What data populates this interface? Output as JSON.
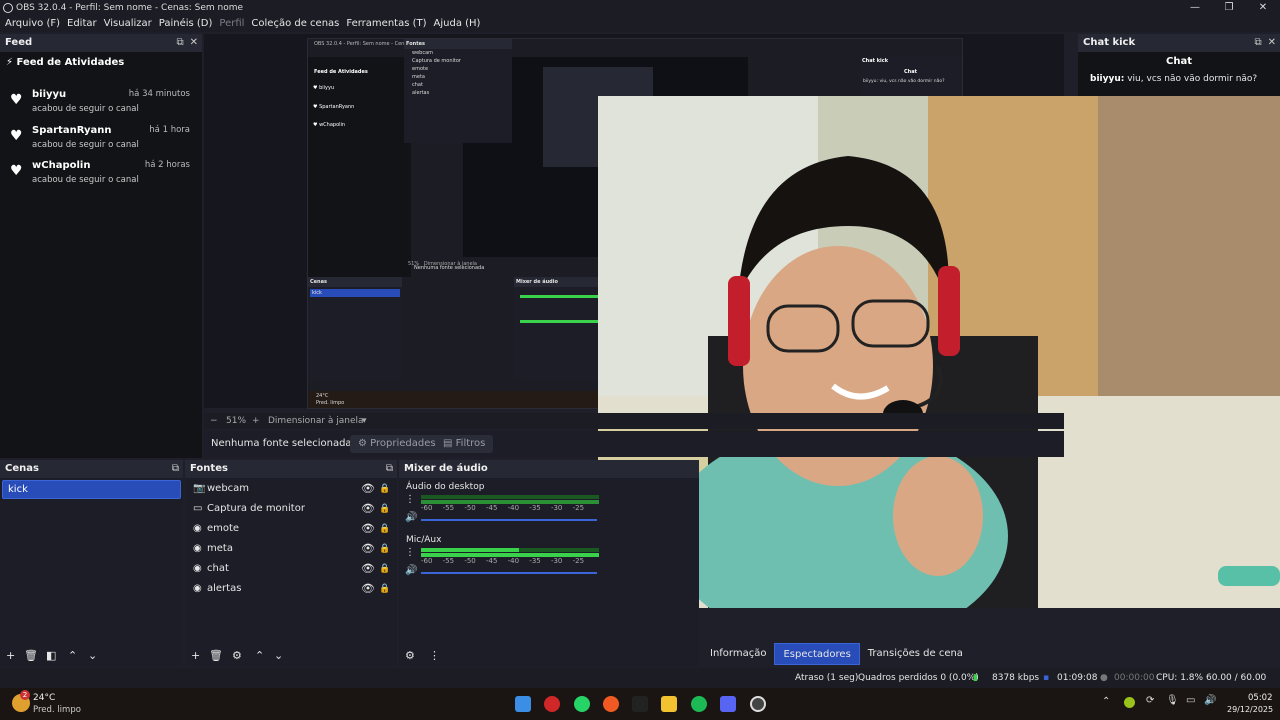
{
  "window": {
    "title": "OBS 32.0.4 - Perfil: Sem nome - Cenas: Sem nome",
    "controls": [
      "—",
      "❐",
      "✕"
    ]
  },
  "menu": {
    "items": [
      "Arquivo (F)",
      "Editar",
      "Visualizar",
      "Painéis (D)",
      "Perfil",
      "Coleção de cenas",
      "Ferramentas (T)",
      "Ajuda (H)"
    ]
  },
  "feed": {
    "dock_title": "Feed",
    "panel_title": "Feed de Atividades",
    "items": [
      {
        "name": "biiyyu",
        "time": "há 34 minutos",
        "action": "acabou de seguir o canal"
      },
      {
        "name": "SpartanRyann",
        "time": "há 1 hora",
        "action": "acabou de seguir o canal"
      },
      {
        "name": "wChapolin",
        "time": "há 2 horas",
        "action": "acabou de seguir o canal"
      }
    ]
  },
  "chat": {
    "dock_title": "Chat kick",
    "heading": "Chat",
    "messages": [
      {
        "user": "biiyyu:",
        "text": "viu, vcs não vão dormir não?"
      }
    ]
  },
  "preview": {
    "zoom": "51%",
    "zoom_mode": "Dimensionar à janela",
    "no_source": "Nenhuma fonte selecionada",
    "properties": "Propriedades",
    "filters": "Filtros"
  },
  "scenes": {
    "title": "Cenas",
    "items": [
      "kick"
    ]
  },
  "sources": {
    "title": "Fontes",
    "items": [
      {
        "label": "webcam",
        "icon": "camera-icon"
      },
      {
        "label": "Captura de monitor",
        "icon": "monitor-icon"
      },
      {
        "label": "emote",
        "icon": "browser-icon"
      },
      {
        "label": "meta",
        "icon": "browser-icon"
      },
      {
        "label": "chat",
        "icon": "browser-icon"
      },
      {
        "label": "alertas",
        "icon": "browser-icon"
      }
    ]
  },
  "mixer": {
    "title": "Mixer de áudio",
    "tracks": [
      {
        "name": "Áudio do desktop",
        "level": 0.0
      },
      {
        "name": "Mic/Aux",
        "level": 0.55
      }
    ],
    "scale": "-60 -55 -50 -45 -40 -35 -30 -25"
  },
  "tabs": [
    "Informação",
    "Espectadores",
    "Transições de cena"
  ],
  "status": {
    "delay": "Atraso (1 seg)",
    "dropped": "Quadros perdidos 0 (0.0%)",
    "bitrate": "8378 kbps",
    "live_time": "01:09:08",
    "rec_time": "00:00:00",
    "cpu": "CPU: 1.8%",
    "fps": "60.00 / 60.00 FPS"
  },
  "taskbar": {
    "temp": "24°C",
    "weather": "Pred. limpo",
    "time": "05:02",
    "date": "29/12/2025",
    "badge": "2"
  },
  "nested": {
    "title": "OBS 32.0.4 - Perfil: Sem nome - Cenas: Sem nome",
    "feed_title": "Feed de Atividades",
    "chat_title": "Chat kick",
    "chat_heading": "Chat",
    "chat_line": "biiyyu: viu, vcs não vão dormir não?",
    "zoom": "51%",
    "zoom_mode": "Dimensionar à janela",
    "no_source": "Nenhuma fonte selecionada",
    "scenes_title": "Cenas",
    "sources_title": "Fontes",
    "mixer_title": "Mixer de áudio",
    "temp": "24°C",
    "weather": "Pred. limpo"
  },
  "colors": {
    "accent": "#284cb8",
    "meter_green": "#3ad24a",
    "background": "#1c1d27"
  }
}
